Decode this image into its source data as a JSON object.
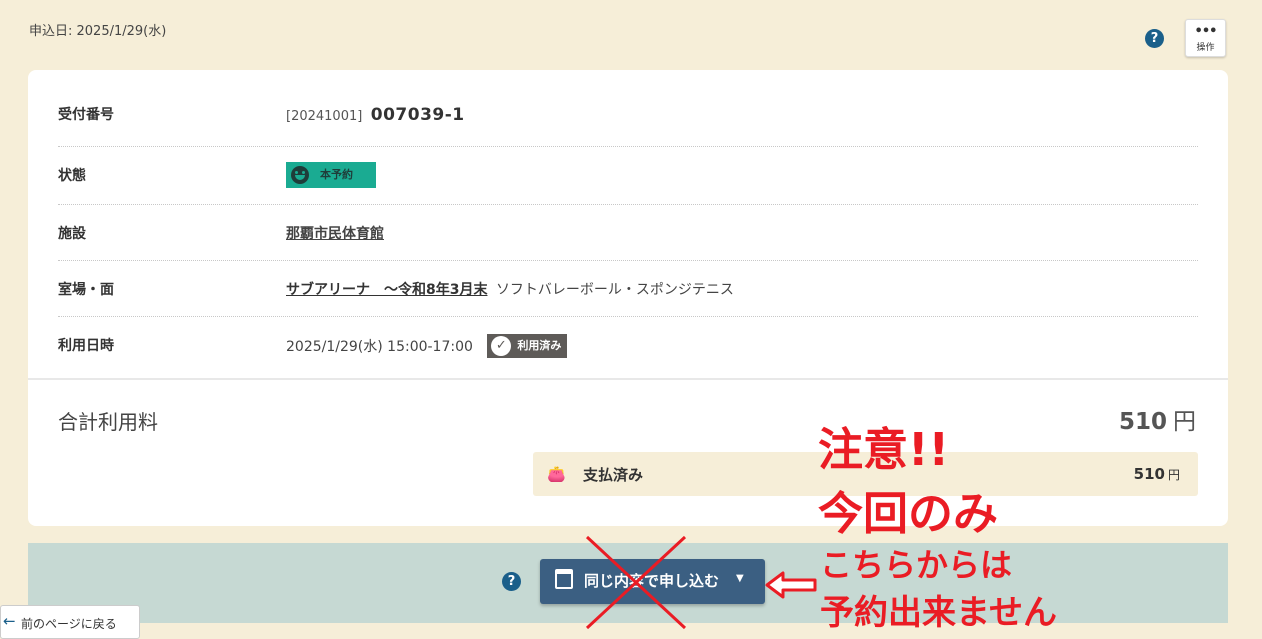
{
  "header": {
    "applied_date": "申込日: 2025/1/29(水)",
    "help_icon_glyph": "?",
    "ops_dots": "•••",
    "ops_label": "操作"
  },
  "detail": {
    "receipt": {
      "label": "受付番号",
      "prefix": "[20241001]",
      "number": "007039-1"
    },
    "status": {
      "label": "状態",
      "badge": "本予約",
      "badge_color": "#1aab92",
      "icon": "smile-icon"
    },
    "facility": {
      "label": "施設",
      "value": "那覇市民体育館"
    },
    "room": {
      "label": "室場・面",
      "link": "サブアリーナ　～令和8年3月末",
      "sport": "ソフトバレーボール・スポンジテニス"
    },
    "datetime": {
      "label": "利用日時",
      "value": "2025/1/29(水) 15:00-17:00",
      "badge": "利用済み",
      "badge_icon": "check-circle-icon"
    }
  },
  "fee": {
    "label": "合計利用料",
    "amount": "510",
    "currency": "円",
    "paid": {
      "label": "支払済み",
      "amount": "510",
      "currency": "円",
      "icon": "wallet-icon"
    }
  },
  "actions": {
    "help_glyph": "?",
    "apply_label": "同じ内容で申し込む",
    "caret": "▼",
    "apply_color": "#3b5f82"
  },
  "footer": {
    "back_label": "前のページに戻る",
    "back_arrow": "←"
  },
  "annotation": {
    "line1": "注意!!",
    "line2": "今回のみ",
    "line3": "こちらからは",
    "line4": "予約出来ません",
    "color": "#ea1c24"
  }
}
